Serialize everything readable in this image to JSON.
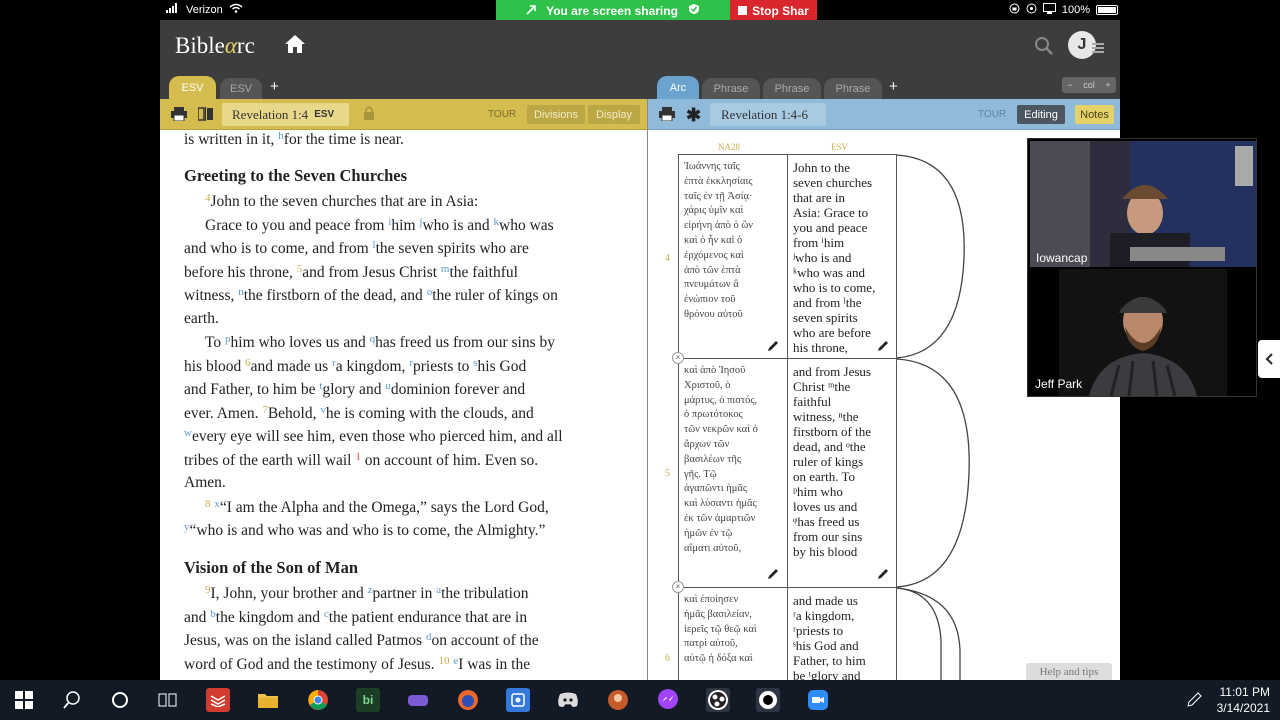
{
  "status_bar": {
    "carrier": "Verizon",
    "battery": "100%"
  },
  "zoom_share": {
    "sharing_text": "You are screen sharing",
    "stop_text": "Stop Shar"
  },
  "app": {
    "logo_prefix": "Bible",
    "logo_alpha": "α",
    "logo_suffix": "rc"
  },
  "tabs": {
    "left": [
      "ESV",
      "ESV"
    ],
    "right": [
      "Arc",
      "Phrase",
      "Phrase",
      "Phrase"
    ],
    "col_control": {
      "minus": "−",
      "label": "col",
      "plus": "+"
    }
  },
  "left_toolbar": {
    "reference": "Revelation 1:4",
    "version": "ESV",
    "tour": "TOUR",
    "divisions": "Divisions",
    "display": "Display"
  },
  "right_toolbar": {
    "reference": "Revelation 1:4-6",
    "tour": "TOUR",
    "editing": "Editing",
    "notes": "Notes"
  },
  "passage": {
    "intro": "is written in it, ",
    "intro_fn": "h",
    "intro_end": "for the time is near.",
    "heading1": "Greeting to the Seven Churches",
    "heading2": "Vision of the Son of Man",
    "l1": "John to the seven churches that are in Asia:",
    "l2a": "Grace to you and peace from ",
    "l2b": "him ",
    "l2c": "who is and ",
    "l2d": "who was",
    "l3a": "and who is to come, and from ",
    "l3b": "the seven spirits who are",
    "l4a": "before his throne, ",
    "l4b": "and from Jesus Christ ",
    "l4c": "the faithful",
    "l5a": "witness, ",
    "l5b": "the firstborn of the dead, and ",
    "l5c": "the ruler of kings on",
    "l6": "earth.",
    "l7a": "To ",
    "l7b": "him who loves us and ",
    "l7c": "has freed us from our sins by",
    "l8a": "his blood ",
    "l8b": "and made us ",
    "l8c": "a kingdom, ",
    "l8d": "priests to ",
    "l8e": "his God",
    "l9a": "and Father, to him be ",
    "l9b": "glory and ",
    "l9c": "dominion forever and",
    "l10a": "ever. Amen. ",
    "l10b": "Behold, ",
    "l10c": "he is coming with the clouds, and",
    "l11": "every eye will see him, even those who pierced him, and all",
    "l12a": "tribes of the earth will wail ",
    "l12b": " on account of him. Even so.",
    "l13": "Amen.",
    "l14": "“I am the Alpha and the Omega,” says the Lord God,",
    "l15": "“who is and who was and who is to come, the Almighty.”",
    "l16a": "I, John, your brother and ",
    "l16b": "partner in ",
    "l16c": "the tribulation",
    "l17a": "and ",
    "l17b": "the kingdom and ",
    "l17c": "the patient endurance that are in",
    "l18a": "Jesus, was on the island called Patmos ",
    "l18b": "on account of the",
    "l19a": "word of God and the testimony of Jesus. ",
    "l19b": "I was in the",
    "verse_numbers": {
      "v4": "4",
      "v6": "6",
      "v7": "7",
      "v8": "8",
      "v9": "9",
      "v10": "10"
    },
    "footnotes": {
      "i": "i",
      "j": "j",
      "k": "k",
      "l": "l",
      "m": "m",
      "n": "n",
      "o": "o",
      "p": "p",
      "q": "q",
      "r": "r",
      "s": "s",
      "t": "t",
      "u": "u",
      "v": "v",
      "w": "w",
      "x": "x",
      "y": "y",
      "z": "z",
      "a": "a",
      "b": "b",
      "c": "c",
      "d": "d",
      "e": "e",
      "red": "1"
    }
  },
  "arc": {
    "col_greek": "NA28",
    "col_english": "ESV",
    "rows": [
      {
        "verse": "4",
        "greek": [
          "Ἰωάννης ταῖς",
          "ἑπτὰ ἐκκλησίαις",
          "ταῖς ἐν τῇ Ἀσίᾳ·",
          "χάρις ὑμῖν καὶ",
          "εἰρήνη ἀπὸ ὁ ὢν",
          "καὶ ὁ ἦν καὶ ὁ",
          "ἐρχόμενος καὶ",
          "ἀπὸ τῶν ἑπτὰ",
          "πνευμάτων ἃ",
          "ἐνώπιον τοῦ",
          "θρόνου αὐτοῦ"
        ],
        "english": [
          "John to the",
          "seven churches",
          "that are in",
          "Asia: Grace to",
          "you and peace",
          "from ⁱhim",
          "ʲwho is and",
          "ᵏwho was and",
          "who is to come,",
          "and from ˡthe",
          "seven spirits",
          "who are before",
          "his throne,"
        ]
      },
      {
        "verse": "5",
        "greek": [
          "καὶ ἀπὸ Ἰησοῦ",
          "Χριστοῦ, ὁ",
          "μάρτυς, ὁ πιστός,",
          "ὁ πρωτότοκος",
          "τῶν νεκρῶν καὶ ὁ",
          "ἄρχων τῶν",
          "βασιλέων τῆς",
          "γῆς. Τῷ",
          "ἀγαπῶντι ἡμᾶς",
          "καὶ λύσαντι ἡμᾶς",
          "ἐκ τῶν ἁμαρτιῶν",
          "ἡμῶν ἐν τῷ",
          "αἵματι αὐτοῦ,"
        ],
        "english": [
          "and from Jesus",
          "Christ ᵐthe",
          "faithful",
          "witness, ⁿthe",
          "firstborn of the",
          "dead, and ᵒthe",
          "ruler of kings",
          "on earth. To",
          "ᵖhim who",
          "loves us and",
          "ᵠhas freed us",
          "from our sins",
          "by his blood"
        ]
      },
      {
        "verse": "6",
        "greek": [
          "καὶ ἐποίησεν",
          "ἡμᾶς βασιλείαν,",
          "ἱερεῖς τῷ θεῷ καὶ",
          "πατρὶ αὐτοῦ,",
          "αὐτῷ ἡ δόξα καὶ"
        ],
        "english": [
          "and made us",
          "ʳa kingdom,",
          "ʳpriests to",
          "ˢhis God and",
          "Father, to him",
          "be ᵗglory and"
        ]
      }
    ],
    "help": "Help and tips"
  },
  "video": {
    "participant1": "Iowancap",
    "participant2": "Jeff Park"
  },
  "taskbar": {
    "time": "11:01 PM",
    "date": "3/14/2021"
  }
}
